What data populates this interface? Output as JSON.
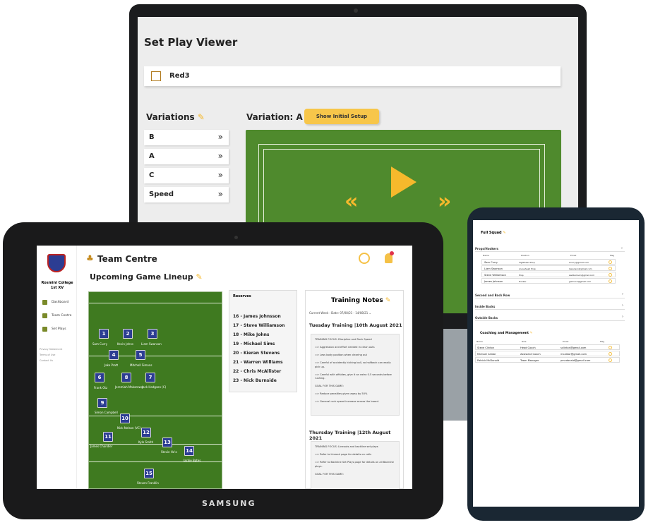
{
  "laptop": {
    "title": "Set Play Viewer",
    "play_name": "Red3",
    "variations_label": "Variations",
    "variation_header": "Variation: A",
    "show_setup_button": "Show Initial Setup",
    "variations": [
      {
        "label": "B"
      },
      {
        "label": "A"
      },
      {
        "label": "C"
      },
      {
        "label": "Speed"
      }
    ],
    "chevron": "»",
    "rewind_symbol": "«",
    "forward_symbol": "»",
    "field_color": "#4f8a2d",
    "accent": "#f6b92c"
  },
  "tablet": {
    "brand": "SAMSUNG",
    "school": "Rosmini College",
    "team": "1st XV",
    "nav": [
      {
        "label": "Dashboard"
      },
      {
        "label": "Team Centre"
      },
      {
        "label": "Set Plays"
      }
    ],
    "footer_links": [
      "Privacy Statement",
      "Terms of Use",
      "Contact Us"
    ],
    "title": "Team Centre",
    "section_title": "Upcoming Game Lineup",
    "players": [
      {
        "num": "1",
        "name": "Sam Curry"
      },
      {
        "num": "2",
        "name": "Kevin Johns"
      },
      {
        "num": "3",
        "name": "Liam Swanson"
      },
      {
        "num": "4",
        "name": "Jake Pratt"
      },
      {
        "num": "5",
        "name": "Mitchell Simons"
      },
      {
        "num": "6",
        "name": "Frank Otz"
      },
      {
        "num": "8",
        "name": "Jeremiah Makarewa"
      },
      {
        "num": "7",
        "name": "Jack Hodgson (C)"
      },
      {
        "num": "9",
        "name": "Simon Campbell"
      },
      {
        "num": "10",
        "name": "Nick Nelson (VC)"
      },
      {
        "num": "11",
        "name": "James Chandler"
      },
      {
        "num": "12",
        "name": "Kyle Smith"
      },
      {
        "num": "13",
        "name": "Stevie Ho'o"
      },
      {
        "num": "14",
        "name": "Jackie Bates"
      },
      {
        "num": "15",
        "name": "Steven Franklin"
      }
    ],
    "reserves_label": "Reserves",
    "reserves": [
      "16 - James Johnsson",
      "17 - Steve Williamson",
      "18 - Mike Johns",
      "19 - Michael Sims",
      "20 - Kieran Stevens",
      "21 - Warren Williams",
      "22 - Chris McAllister",
      "23 - Nick Burnside"
    ],
    "notes_title": "Training Notes",
    "current_week": "Current Week : Date: 07/08/21 - 14/08/21",
    "tuesday_title": "Tuesday Training  |10th August 2021",
    "tuesday_focus": "TRAINING FOCUS: Discipline and Ruck Speed",
    "tuesday_items": [
      "=> Aggression and effort needed in clean outs",
      "=> Less body position when clearing out",
      "=> Careful of accidently kicking ball, so halfback can easily pick up.",
      "=> Careful with offsides, give it an extra 0.5 seconds before rushing."
    ],
    "tuesday_goal": "GOAL FOR THIS GAME:",
    "tuesday_goal_items": [
      "=> Reduce penalties given away by 50%",
      "=> General ruck speed increase across the board."
    ],
    "thursday_title": "Thursday Training  |12th August 2021",
    "thursday_focus": "TRAINING FOCUS: Lineouts and backline set plays",
    "thursday_items": [
      "=> Refer to Lineout page for details on calls",
      "=> Refer to Backline Set Plays page for details on all Backline plays."
    ],
    "thursday_goal": "GOAL FOR THIS GAME:"
  },
  "phone": {
    "squad_title": "Full Squad",
    "props_section": "Props/Hookers",
    "columns": [
      "Name",
      "Position",
      "Email",
      "Msg"
    ],
    "props": [
      {
        "name": "Sam Curry",
        "position": "Tighthead Prop",
        "email": "scurry@gmail.com"
      },
      {
        "name": "Liam Swanson",
        "position": "Loosehead Prop",
        "email": "lswanson@gmail.com"
      },
      {
        "name": "Steve Williamson",
        "position": "Prop",
        "email": "swilliamson@gmail.com"
      },
      {
        "name": "James Johnson",
        "position": "Hooker",
        "email": "jjohnson@gmail.com"
      }
    ],
    "sections": [
      "Second and Back Row",
      "Inside Backs",
      "Outside Backs"
    ],
    "coaching_title": "Coaching and Management",
    "coaching_columns": [
      "Name",
      "Role",
      "Email",
      "Msg"
    ],
    "coaches": [
      {
        "name": "Steve Clinton",
        "role": "Head Coach",
        "email": "sclinton@gmail.com"
      },
      {
        "name": "Michael Caldor",
        "role": "Assistant Coach",
        "email": "mcaldor@gmail.com"
      },
      {
        "name": "Patrick McDonald",
        "role": "Team Manager",
        "email": "pmcdonald@gmail.com"
      }
    ]
  }
}
